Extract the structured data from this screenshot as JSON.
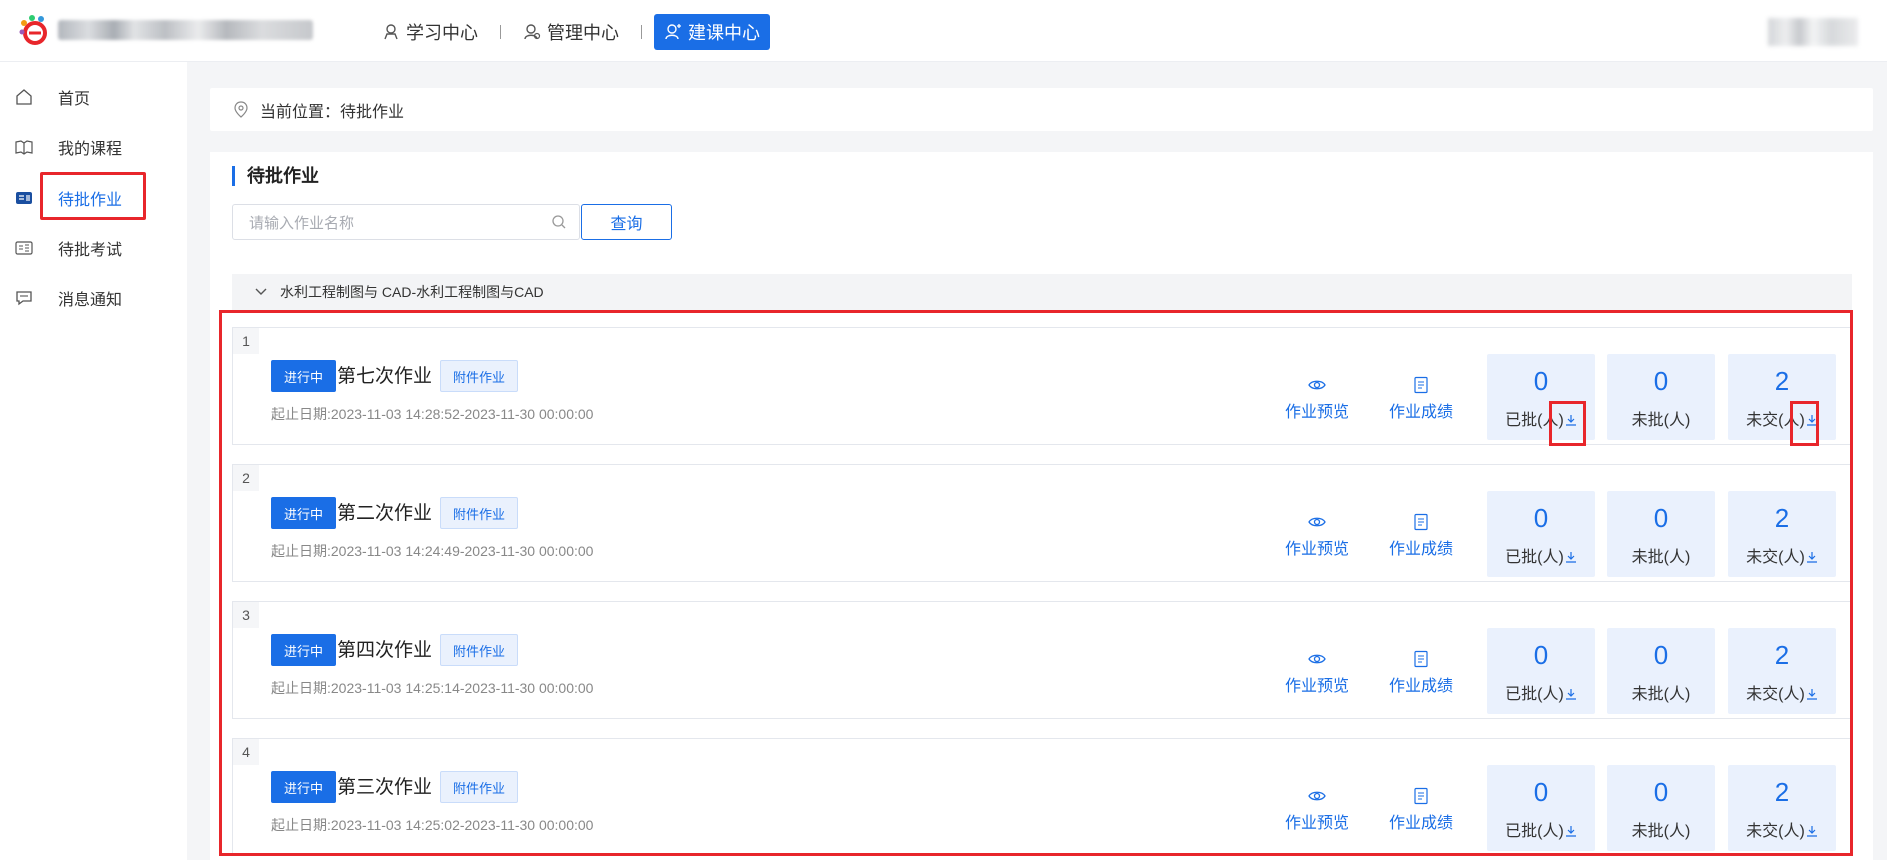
{
  "header": {
    "nav": [
      {
        "label": "学习中心",
        "icon": "study-icon",
        "active": false
      },
      {
        "label": "管理中心",
        "icon": "manage-icon",
        "active": false
      },
      {
        "label": "建课中心",
        "icon": "build-course-icon",
        "active": true
      }
    ]
  },
  "sidebar": {
    "items": [
      {
        "label": "首页",
        "icon": "home-icon"
      },
      {
        "label": "我的课程",
        "icon": "book-icon"
      },
      {
        "label": "待批作业",
        "icon": "homework-icon",
        "active": true
      },
      {
        "label": "待批考试",
        "icon": "exam-icon"
      },
      {
        "label": "消息通知",
        "icon": "message-icon"
      }
    ]
  },
  "breadcrumb": {
    "text": "当前位置：待批作业"
  },
  "main": {
    "title": "待批作业",
    "search_placeholder": "请输入作业名称",
    "query_label": "查询",
    "group_title": "水利工程制图与 CAD-水利工程制图与CAD",
    "preview_label": "作业预览",
    "score_label": "作业成绩",
    "approved_label": "已批(人)",
    "unapproved_label": "未批(人)",
    "unsubmitted_label": "未交(人)",
    "assignments": [
      {
        "index": "1",
        "status": "进行中",
        "title": "第七次作业",
        "tag": "附件作业",
        "dates": "起止日期:2023-11-03 14:28:52-2023-11-30 00:00:00",
        "approved": "0",
        "unapproved": "0",
        "unsubmitted": "2"
      },
      {
        "index": "2",
        "status": "进行中",
        "title": "第二次作业",
        "tag": "附件作业",
        "dates": "起止日期:2023-11-03 14:24:49-2023-11-30 00:00:00",
        "approved": "0",
        "unapproved": "0",
        "unsubmitted": "2"
      },
      {
        "index": "3",
        "status": "进行中",
        "title": "第四次作业",
        "tag": "附件作业",
        "dates": "起止日期:2023-11-03 14:25:14-2023-11-30 00:00:00",
        "approved": "0",
        "unapproved": "0",
        "unsubmitted": "2"
      },
      {
        "index": "4",
        "status": "进行中",
        "title": "第三次作业",
        "tag": "附件作业",
        "dates": "起止日期:2023-11-03 14:25:02-2023-11-30 00:00:00",
        "approved": "0",
        "unapproved": "0",
        "unsubmitted": "2"
      }
    ]
  },
  "colors": {
    "primary": "#1a6ee6",
    "highlight": "#e8262b",
    "stat_bg": "#eaf1fd"
  }
}
